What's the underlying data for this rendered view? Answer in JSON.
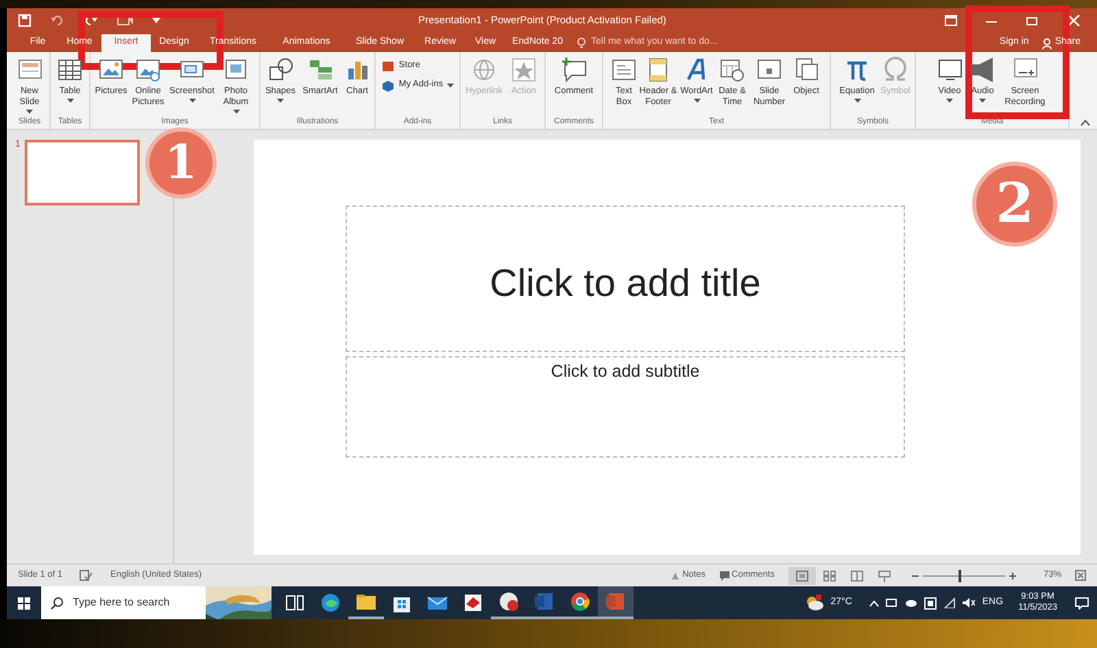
{
  "window": {
    "title": "Presentation1 - PowerPoint (Product Activation Failed)"
  },
  "tabs": [
    {
      "label": "File",
      "selected": false
    },
    {
      "label": "Home",
      "selected": false
    },
    {
      "label": "Insert",
      "selected": true
    },
    {
      "label": "Design",
      "selected": false
    },
    {
      "label": "Transitions",
      "selected": false
    },
    {
      "label": "Animations",
      "selected": false
    },
    {
      "label": "Slide Show",
      "selected": false
    },
    {
      "label": "Review",
      "selected": false
    },
    {
      "label": "View",
      "selected": false
    },
    {
      "label": "EndNote 20",
      "selected": false
    }
  ],
  "tell_me": {
    "placeholder": "Tell me what you want to do..."
  },
  "account": {
    "sign_in": "Sign in",
    "share": "Share"
  },
  "ribbon": {
    "groups": [
      {
        "label": "Slides",
        "buttons": [
          {
            "kind": "large",
            "label": "New Slide",
            "menu": true,
            "disabled": false
          }
        ]
      },
      {
        "label": "Tables",
        "buttons": [
          {
            "kind": "large",
            "label": "Table",
            "menu": true,
            "disabled": false
          }
        ]
      },
      {
        "label": "Images",
        "buttons": [
          {
            "kind": "large",
            "label": "Pictures",
            "menu": false,
            "disabled": false
          },
          {
            "kind": "large",
            "label": "Online Pictures",
            "menu": false,
            "disabled": false
          },
          {
            "kind": "large",
            "label": "Screenshot",
            "menu": true,
            "disabled": false
          },
          {
            "kind": "large",
            "label": "Photo Album",
            "menu": true,
            "disabled": false
          }
        ]
      },
      {
        "label": "Illustrations",
        "buttons": [
          {
            "kind": "large",
            "label": "Shapes",
            "menu": true,
            "disabled": false
          },
          {
            "kind": "large",
            "label": "SmartArt",
            "menu": false,
            "disabled": false
          },
          {
            "kind": "large",
            "label": "Chart",
            "menu": false,
            "disabled": false
          }
        ]
      },
      {
        "label": "Add-ins",
        "buttons": [
          {
            "kind": "small",
            "label": "Store",
            "menu": false,
            "disabled": false
          },
          {
            "kind": "small",
            "label": "My Add-ins",
            "menu": true,
            "disabled": false
          }
        ]
      },
      {
        "label": "Links",
        "buttons": [
          {
            "kind": "large",
            "label": "Hyperlink",
            "menu": false,
            "disabled": true
          },
          {
            "kind": "large",
            "label": "Action",
            "menu": false,
            "disabled": true
          }
        ]
      },
      {
        "label": "Comments",
        "buttons": [
          {
            "kind": "large",
            "label": "Comment",
            "menu": false,
            "disabled": false
          }
        ]
      },
      {
        "label": "Text",
        "buttons": [
          {
            "kind": "large",
            "label": "Text Box",
            "menu": false,
            "disabled": false
          },
          {
            "kind": "large",
            "label": "Header & Footer",
            "menu": false,
            "disabled": false
          },
          {
            "kind": "large",
            "label": "WordArt",
            "menu": true,
            "disabled": false
          },
          {
            "kind": "large",
            "label": "Date & Time",
            "menu": false,
            "disabled": false
          },
          {
            "kind": "large",
            "label": "Slide Number",
            "menu": false,
            "disabled": false
          },
          {
            "kind": "large",
            "label": "Object",
            "menu": false,
            "disabled": false
          }
        ]
      },
      {
        "label": "Symbols",
        "buttons": [
          {
            "kind": "large",
            "label": "Equation",
            "menu": true,
            "disabled": false
          },
          {
            "kind": "large",
            "label": "Symbol",
            "menu": false,
            "disabled": true
          }
        ]
      },
      {
        "label": "Media",
        "buttons": [
          {
            "kind": "large",
            "label": "Video",
            "menu": true,
            "disabled": false
          },
          {
            "kind": "large",
            "label": "Audio",
            "menu": true,
            "disabled": false
          },
          {
            "kind": "large",
            "label": "Screen Recording",
            "menu": false,
            "disabled": false
          }
        ]
      }
    ]
  },
  "thumbnails": [
    {
      "number": "1",
      "selected": true
    }
  ],
  "slide": {
    "title_placeholder": "Click to add title",
    "subtitle_placeholder": "Click to add subtitle"
  },
  "callouts": [
    {
      "label": "1"
    },
    {
      "label": "2"
    }
  ],
  "status_bar": {
    "slide_count": "Slide 1 of 1",
    "language": "English (United States)",
    "notes": "Notes",
    "comments": "Comments",
    "views": [
      {
        "selected": true
      },
      {
        "selected": false
      },
      {
        "selected": false
      },
      {
        "selected": false
      }
    ],
    "zoom": {
      "level": 0.45,
      "reading": "73%"
    }
  },
  "taskbar": {
    "search": {
      "placeholder": "Type here to search"
    },
    "apps": [
      {
        "running": false,
        "active": false
      },
      {
        "running": false,
        "active": false
      },
      {
        "running": true,
        "active": false
      },
      {
        "running": false,
        "active": false
      },
      {
        "running": false,
        "active": false
      },
      {
        "running": false,
        "active": false
      },
      {
        "running": true,
        "active": false
      },
      {
        "running": true,
        "active": false
      },
      {
        "running": true,
        "active": false
      },
      {
        "running": true,
        "active": true
      }
    ],
    "weather": "27°C",
    "language": "ENG",
    "time": "9:03 PM",
    "date": "11/5/2023"
  }
}
